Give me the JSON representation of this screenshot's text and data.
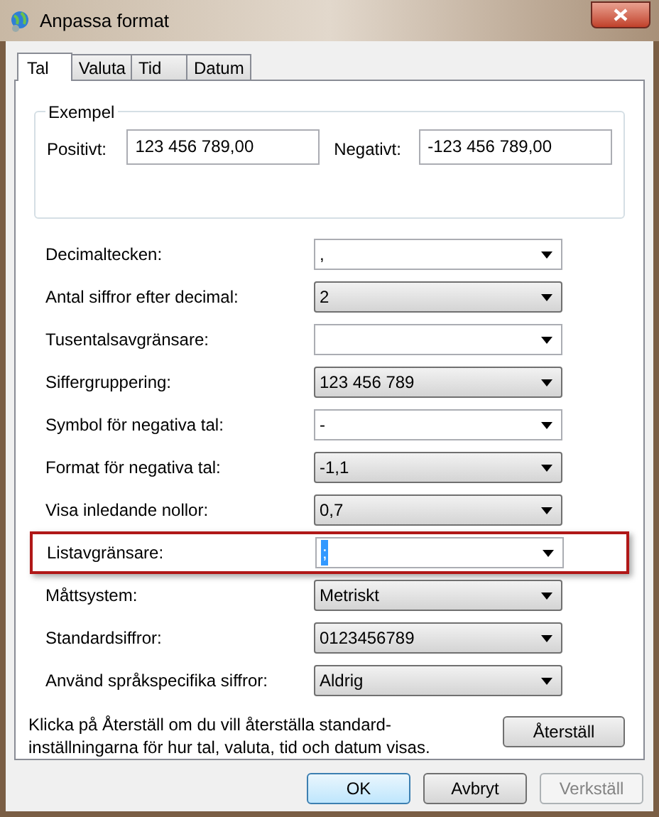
{
  "window": {
    "title": "Anpassa format"
  },
  "tabs": [
    {
      "label": "Tal",
      "selected": true
    },
    {
      "label": "Valuta",
      "selected": false
    },
    {
      "label": "Tid",
      "selected": false
    },
    {
      "label": "Datum",
      "selected": false
    }
  ],
  "example": {
    "title": "Exempel",
    "positive_label": "Positivt:",
    "positive_value": "123 456 789,00",
    "negative_label": "Negativt:",
    "negative_value": "-123 456 789,00"
  },
  "settings": [
    {
      "label": "Decimaltecken:",
      "value": ",",
      "kind": "edit",
      "highlighted": false
    },
    {
      "label": "Antal siffror efter decimal:",
      "value": "2",
      "kind": "list",
      "highlighted": false
    },
    {
      "label": "Tusentalsavgränsare:",
      "kind": "edit",
      "highlighted": false
    },
    {
      "label": "Siffergruppering:",
      "value": "123 456 789",
      "kind": "list",
      "highlighted": false
    },
    {
      "label": "Symbol för negativa tal:",
      "value": "-",
      "kind": "edit",
      "highlighted": false
    },
    {
      "label": "Format för negativa tal:",
      "value": "-1,1",
      "kind": "list",
      "highlighted": false
    },
    {
      "label": "Visa inledande nollor:",
      "value": "0,7",
      "kind": "list",
      "highlighted": false
    },
    {
      "label": "Listavgränsare:",
      "value": ";",
      "kind": "edit",
      "highlighted": true
    },
    {
      "label": "Måttsystem:",
      "value": "Metriskt",
      "kind": "list",
      "highlighted": false
    },
    {
      "label": "Standardsiffror:",
      "value": "0123456789",
      "kind": "list",
      "highlighted": false
    },
    {
      "label": "Använd språkspecifika siffror:",
      "value": "Aldrig",
      "kind": "list",
      "highlighted": false
    }
  ],
  "reset_text": "Klicka på Återställ om du vill återställa standard-inställningarna för hur tal, valuta, tid och datum visas.",
  "reset_button": "Återställ",
  "buttons": [
    {
      "label": "OK",
      "default": true,
      "disabled": false
    },
    {
      "label": "Avbryt",
      "default": false,
      "disabled": false
    },
    {
      "label": "Verkställ",
      "default": false,
      "disabled": true
    }
  ]
}
